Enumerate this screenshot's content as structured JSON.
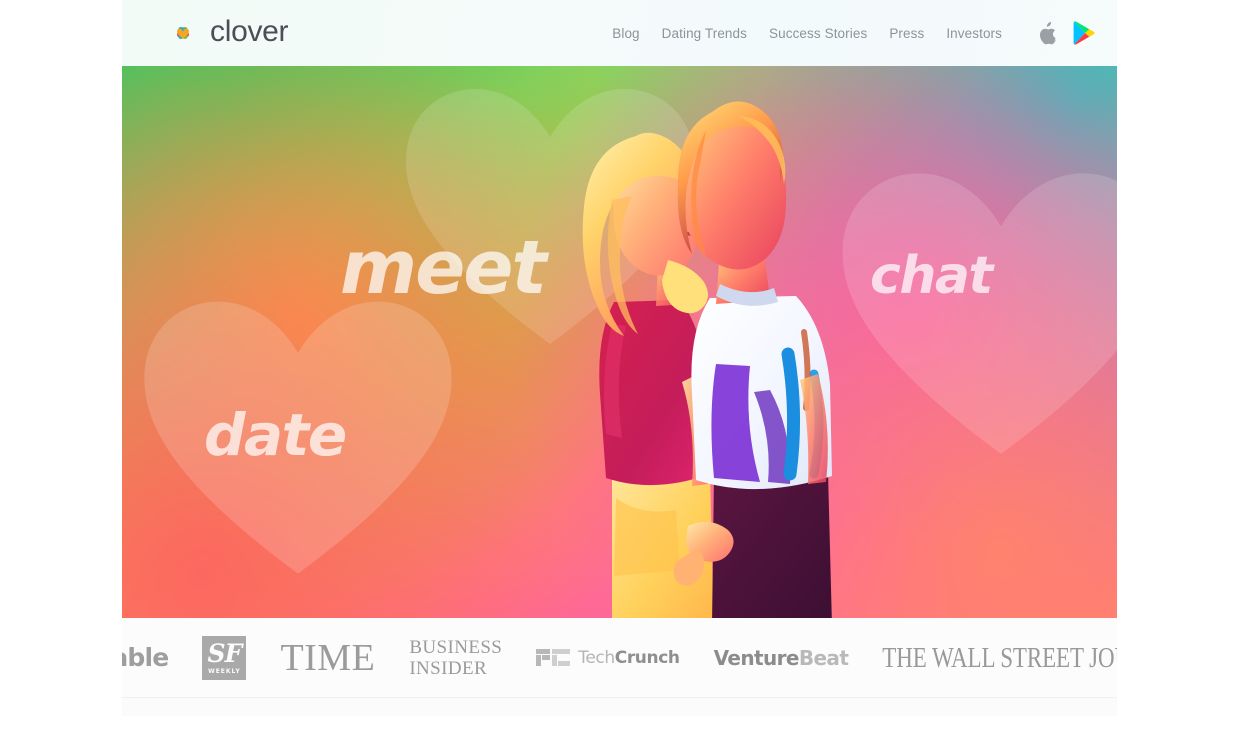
{
  "header": {
    "brand": {
      "name": "clover",
      "icon": "clover-heart-logo"
    },
    "nav": [
      {
        "label": "Blog"
      },
      {
        "label": "Dating Trends"
      },
      {
        "label": "Success Stories"
      },
      {
        "label": "Press"
      },
      {
        "label": "Investors"
      }
    ],
    "store_icons": [
      {
        "name": "apple-app-store-icon",
        "title": "Apple"
      },
      {
        "name": "google-play-store-icon",
        "title": "Google Play"
      }
    ]
  },
  "hero": {
    "words": [
      {
        "text": "meet"
      },
      {
        "text": "chat"
      },
      {
        "text": "date"
      }
    ],
    "image_alt": "Couple holding hands smiling at each other",
    "gradient": {
      "top_left": "#00d664",
      "top_right": "#00dcbe",
      "mid_left": "#ffa83c",
      "mid_right": "#ff46cd",
      "bottom_left": "#fc6860",
      "bottom_right": "#ff846a"
    }
  },
  "press": {
    "logos": [
      {
        "name": "Mashable"
      },
      {
        "name": "SF",
        "sub": "WEEKLY",
        "full": "SF Weekly"
      },
      {
        "name": "TIME"
      },
      {
        "name": "BUSINESS",
        "line2": "INSIDER",
        "full": "Business Insider"
      },
      {
        "name": "Tech",
        "bold": "Crunch",
        "full": "TechCrunch"
      },
      {
        "name": "Venture",
        "bold": "Beat",
        "full": "VentureBeat"
      },
      {
        "name": "THE WALL STREET JOURNAL."
      }
    ]
  }
}
